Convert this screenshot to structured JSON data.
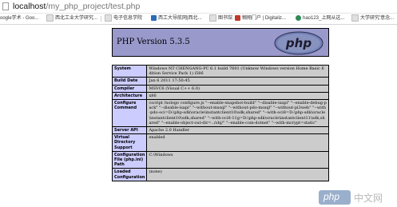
{
  "address_bar": {
    "host": "localhost",
    "path": "/my_php_project/test.php"
  },
  "bookmarks": [
    {
      "label": "oogle学术 - Goo...",
      "icon": "google-icon",
      "color": "#4a7bd0"
    },
    {
      "label": "西北工业大学研究...",
      "icon": "page-icon",
      "color": "#d8d8d8"
    },
    {
      "label": "电子信息学院",
      "icon": "page-icon",
      "color": "#d8d8d8"
    },
    {
      "label": "西工大导航网|西北...",
      "icon": "site-icon",
      "color": "#2a6bb8"
    },
    {
      "label": "图书馆",
      "icon": "page-icon",
      "color": "#d8d8d8"
    },
    {
      "label": "翱翔门户 | Digitaliz...",
      "icon": "portal-icon",
      "color": "#c0392b"
    },
    {
      "label": "hao123_上网从这...",
      "icon": "hao123-icon",
      "color": "#2e8b57"
    },
    {
      "label": "大学研究'意念...",
      "icon": "page-icon",
      "color": "#d8d8d8"
    }
  ],
  "phpinfo": {
    "title": "PHP Version 5.3.5",
    "logo_text": "php",
    "rows": [
      {
        "key": "System",
        "value": "Windows NT CHENGANG-PC 6.1 build 7601 (Unknow Windows version Home Basic Edition Service Pack 1) i586"
      },
      {
        "key": "Build Date",
        "value": "Jan 6 2011 17:50:45"
      },
      {
        "key": "Compiler",
        "value": "MSVC6 (Visual C++ 6.0)"
      },
      {
        "key": "Architecture",
        "value": "x86"
      },
      {
        "key": "Configure Command",
        "value": "cscript /nologo configure.js \"--enable-snapshot-build\" \"--disable-isapi\" \"--enable-debug-pack\" \"--disable-isapi\" \"--without-mssql\" \"--without-pdo-mssql\" \"--without-pi3web\" \"--with-pdo-oci=D:\\php-sdk\\oracle\\instantclient10\\sdk,shared\" \"--with-oci8=D:\\php-sdk\\oracle\\instantclient10\\sdk,shared\" \"--with-oci8-11g=D:\\php-sdk\\oracle\\instantclient11\\sdk,shared\" \"--enable-object-out-dir=../obj/\" \"--enable-com-dotnet\" \"--with-mcrypt=static\""
      },
      {
        "key": "Server API",
        "value": "Apache 2.0 Handler"
      },
      {
        "key": "Virtual Directory Support",
        "value": "enabled"
      },
      {
        "key": "Configuration File (php.ini) Path",
        "value": "C:\\Windows"
      },
      {
        "key": "Loaded Configuration",
        "value": "(none)"
      }
    ]
  },
  "watermark": {
    "badge": "php",
    "text": "中文网"
  }
}
